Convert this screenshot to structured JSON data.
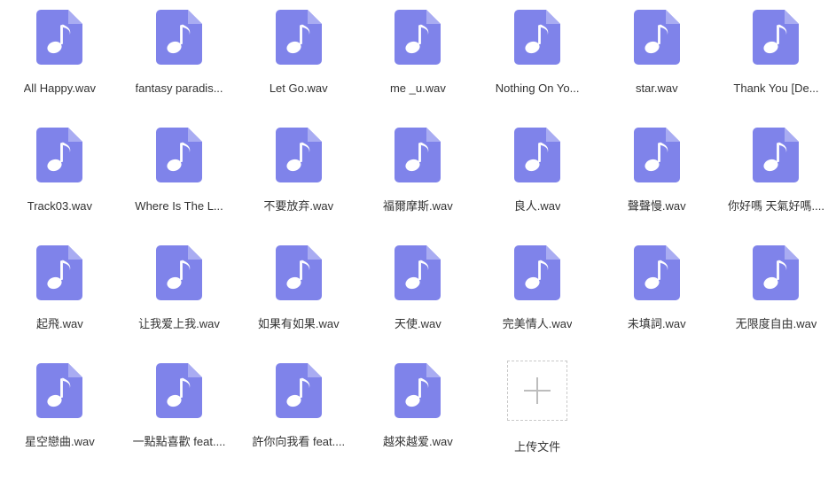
{
  "colors": {
    "icon_body": "#7F83EA",
    "icon_fold": "#A9ACF2",
    "note_fill": "#ffffff",
    "label_text": "#333333",
    "upload_border": "#c9c9c9",
    "upload_plus": "#bdbdbd",
    "background": "#ffffff"
  },
  "icons": {
    "file_icon_name": "audio-file-icon",
    "note_icon_name": "music-note-icon",
    "plus_icon_name": "plus-icon"
  },
  "grid": {
    "columns": 7,
    "rows": 4,
    "files": [
      {
        "name": "All Happy.wav",
        "type": "wav"
      },
      {
        "name": "fantasy paradis...",
        "type": "wav"
      },
      {
        "name": "Let Go.wav",
        "type": "wav"
      },
      {
        "name": "me _u.wav",
        "type": "wav"
      },
      {
        "name": "Nothing On Yo...",
        "type": "wav"
      },
      {
        "name": "star.wav",
        "type": "wav"
      },
      {
        "name": "Thank You [De...",
        "type": "wav"
      },
      {
        "name": "Track03.wav",
        "type": "wav"
      },
      {
        "name": "Where Is The L...",
        "type": "wav"
      },
      {
        "name": "不要放弃.wav",
        "type": "wav"
      },
      {
        "name": "福爾摩斯.wav",
        "type": "wav"
      },
      {
        "name": "良人.wav",
        "type": "wav"
      },
      {
        "name": "聲聲慢.wav",
        "type": "wav"
      },
      {
        "name": "你好嗎 天氣好嗎....",
        "type": "wav"
      },
      {
        "name": "起飛.wav",
        "type": "wav"
      },
      {
        "name": "让我爱上我.wav",
        "type": "wav"
      },
      {
        "name": "如果有如果.wav",
        "type": "wav"
      },
      {
        "name": "天使.wav",
        "type": "wav"
      },
      {
        "name": "完美情人.wav",
        "type": "wav"
      },
      {
        "name": "未填詞.wav",
        "type": "wav"
      },
      {
        "name": "无限度自由.wav",
        "type": "wav"
      },
      {
        "name": "星空戀曲.wav",
        "type": "wav"
      },
      {
        "name": "一點點喜歡 feat....",
        "type": "wav"
      },
      {
        "name": "許你向我看 feat....",
        "type": "wav"
      },
      {
        "name": "越來越爱.wav",
        "type": "wav"
      }
    ]
  },
  "upload": {
    "label": "上传文件"
  }
}
